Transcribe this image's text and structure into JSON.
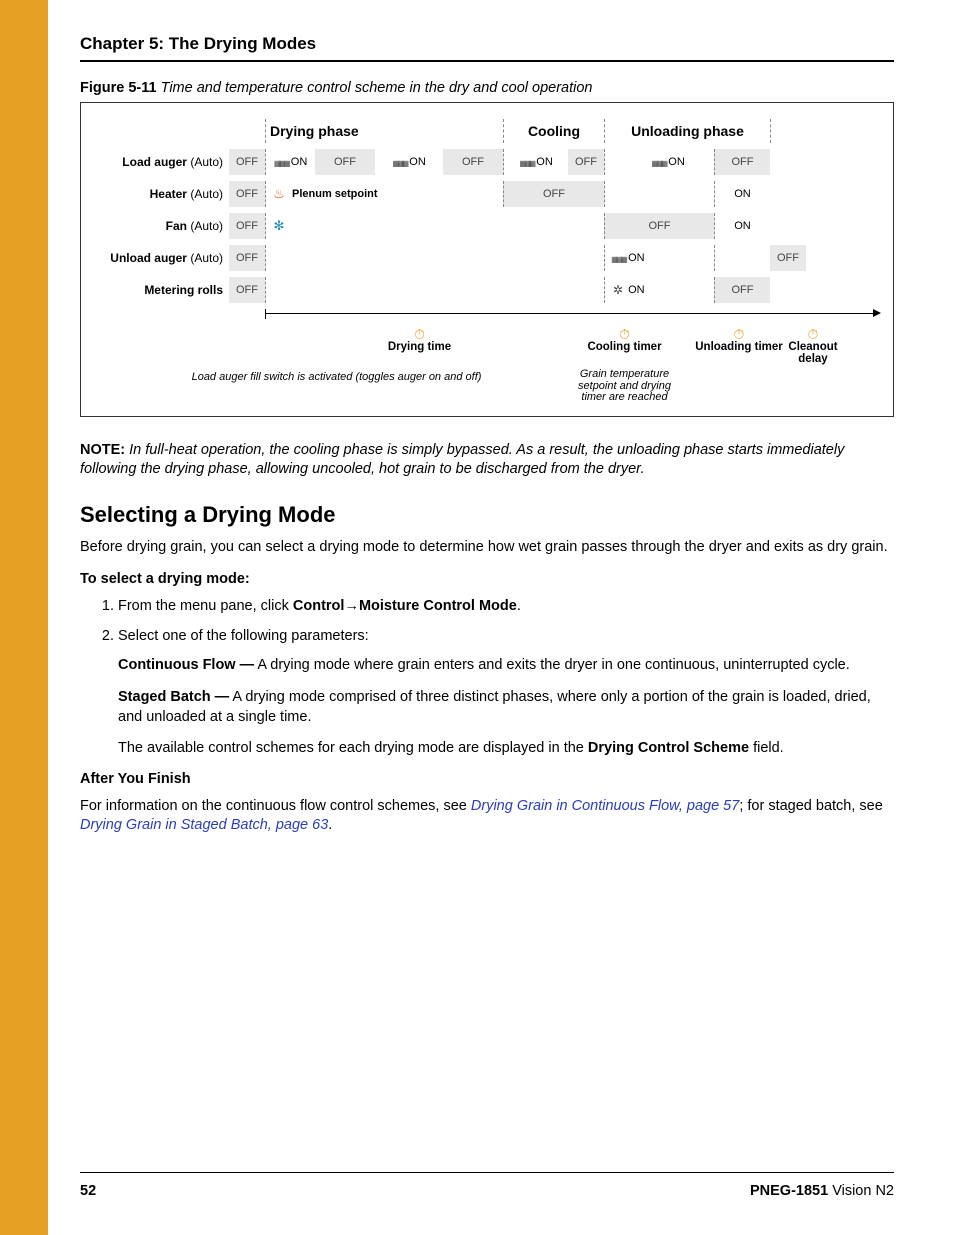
{
  "chapter_title": "Chapter 5: The Drying Modes",
  "figure": {
    "number": "Figure 5-11",
    "caption": "Time and temperature control scheme in the dry and cool operation",
    "phases": {
      "drying": "Drying phase",
      "cooling": "Cooling",
      "unloading": "Unloading phase"
    },
    "rows": {
      "load_auger": {
        "label_bold": "Load auger",
        "label_rest": " (Auto)",
        "cells": [
          "OFF",
          "ON",
          "OFF",
          "ON",
          "OFF",
          "ON",
          "OFF",
          "",
          "ON",
          "OFF",
          ""
        ]
      },
      "heater": {
        "label_bold": "Heater",
        "label_rest": " (Auto)",
        "plenum": "Plenum setpoint",
        "cells_tail": [
          "OFF",
          "",
          "",
          "",
          "ON",
          ""
        ]
      },
      "fan": {
        "label_bold": "Fan",
        "label_rest": " (Auto)",
        "cells": [
          "OFF",
          "",
          "",
          "",
          "",
          "",
          "",
          "",
          "OFF",
          "ON",
          ""
        ]
      },
      "unload_auger": {
        "label_bold": "Unload auger",
        "label_rest": " (Auto)",
        "cells": [
          "OFF",
          "",
          "",
          "",
          "",
          "",
          "",
          "",
          "ON",
          "",
          "OFF"
        ]
      },
      "metering": {
        "label_bold": "Metering rolls",
        "label_rest": "",
        "cells": [
          "OFF",
          "",
          "",
          "",
          "",
          "",
          "",
          "",
          "ON",
          "OFF",
          ""
        ]
      }
    },
    "timers": {
      "drying": "Drying time",
      "cooling": "Cooling timer",
      "unloading": "Unloading timer",
      "cleanout": "Cleanout delay"
    },
    "footnote_left": "Load auger fill switch is activated (toggles auger on and off)",
    "footnote_mid": "Grain temperature setpoint and drying timer are reached"
  },
  "note": {
    "label": "NOTE:",
    "text": " In full-heat operation, the cooling phase is simply bypassed. As a result, the unloading phase starts immediately following the drying phase, allowing uncooled, hot grain to be discharged from the dryer."
  },
  "section_heading": "Selecting a Drying Mode",
  "intro": "Before drying grain, you can select a drying mode to determine how wet grain passes through the dryer and exits as dry grain.",
  "procedure_heading": "To select a drying mode:",
  "steps": {
    "s1_pre": "From the menu pane, click ",
    "s1_b1": "Control",
    "s1_arrow": "→",
    "s1_b2": "Moisture Control Mode",
    "s1_post": ".",
    "s2": "Select one of the following parameters:"
  },
  "params": {
    "cf_label": "Continuous Flow —",
    "cf_text": " A drying mode where grain enters and exits the dryer in one continuous, uninterrupted cycle.",
    "sb_label": "Staged Batch —",
    "sb_text": " A drying mode comprised of three distinct phases, where only a portion of the grain is loaded, dried, and unloaded at a single time.",
    "avail_pre": "The available control schemes for each drying mode are displayed in the ",
    "avail_bold": "Drying Control Scheme",
    "avail_post": " field."
  },
  "after_heading": "After You Finish",
  "after": {
    "pre1": "For information on the continuous flow control schemes, see ",
    "link1": "Drying Grain in Continuous Flow, page 57",
    "mid": "; for staged batch, see ",
    "link2": "Drying Grain in Staged Batch, page 63",
    "post": "."
  },
  "footer": {
    "page": "52",
    "doc_bold": "PNEG-1851",
    "doc_rest": " Vision N2"
  }
}
